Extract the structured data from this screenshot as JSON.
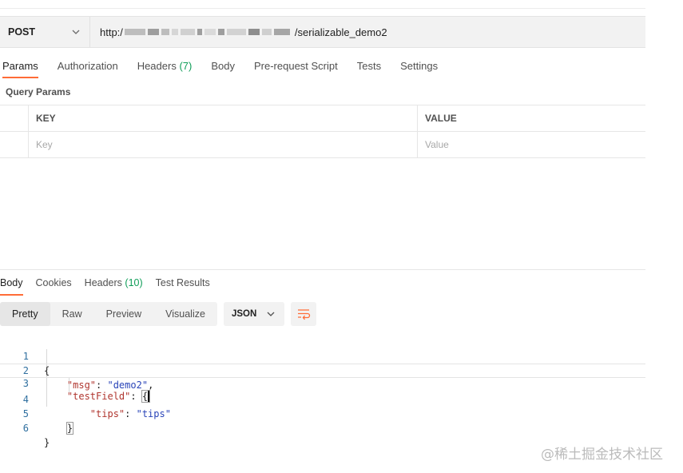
{
  "request": {
    "method": "POST",
    "url_prefix": "http:/",
    "url_suffix": "/serializable_demo2"
  },
  "request_tabs": [
    {
      "label": "Params",
      "active": true
    },
    {
      "label": "Authorization"
    },
    {
      "label": "Headers",
      "count": "(7)"
    },
    {
      "label": "Body"
    },
    {
      "label": "Pre-request Script"
    },
    {
      "label": "Tests"
    },
    {
      "label": "Settings"
    }
  ],
  "query_params": {
    "section_label": "Query Params",
    "key_header": "KEY",
    "value_header": "VALUE",
    "key_placeholder": "Key",
    "value_placeholder": "Value"
  },
  "response_tabs": [
    {
      "label": "Body",
      "active": true
    },
    {
      "label": "Cookies"
    },
    {
      "label": "Headers",
      "count": "(10)"
    },
    {
      "label": "Test Results"
    }
  ],
  "view_modes": [
    "Pretty",
    "Raw",
    "Preview",
    "Visualize"
  ],
  "format": "JSON",
  "code_lines": [
    {
      "n": "1",
      "text": "{"
    },
    {
      "n": "2",
      "key": "\"msg\"",
      "sep": ": ",
      "val": "\"demo2\"",
      "tail": ","
    },
    {
      "n": "3",
      "key": "\"testField\"",
      "sep": ": ",
      "brace": "{"
    },
    {
      "n": "4",
      "key": "\"tips\"",
      "sep": ": ",
      "val": "\"tips\""
    },
    {
      "n": "5",
      "brace": "}"
    },
    {
      "n": "6",
      "text": "}"
    }
  ],
  "watermark": "@稀土掘金技术社区",
  "colors": {
    "accent": "#ff6c37",
    "count": "#0f9d58"
  }
}
